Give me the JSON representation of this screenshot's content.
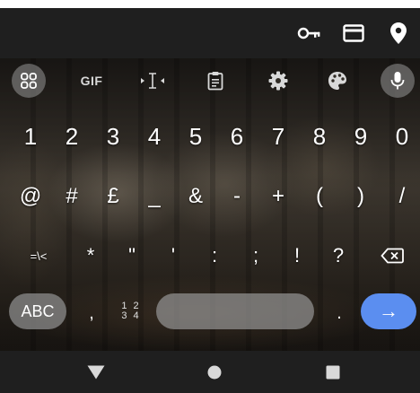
{
  "autofill_bar": {
    "icons": [
      "key-icon",
      "credit-card-icon",
      "location-pin-icon"
    ]
  },
  "keyboard": {
    "toolbar": {
      "gif_label": "GIF",
      "icons": [
        "apps-grid-icon",
        "gif-icon",
        "cursor-control-icon",
        "clipboard-icon",
        "settings-gear-icon",
        "theme-palette-icon",
        "microphone-icon"
      ]
    },
    "row1": [
      "1",
      "2",
      "3",
      "4",
      "5",
      "6",
      "7",
      "8",
      "9",
      "0"
    ],
    "row2": [
      "@",
      "#",
      "£",
      "_",
      "&",
      "-",
      "+",
      "(",
      ")",
      "/"
    ],
    "row3": [
      "=\\<",
      "*",
      "\"",
      "'",
      ":",
      ";",
      "!",
      "?"
    ],
    "row3_backspace_icon": "backspace-icon",
    "bottom_row": {
      "abc_label": "ABC",
      "comma": ",",
      "numpad_top": "1 2",
      "numpad_bottom": "3 4",
      "period": ".",
      "enter_icon": "arrow-right-icon",
      "enter_symbol": "→",
      "enter_color": "#5b8ef0"
    }
  },
  "nav_bar": {
    "icons": [
      "back-triangle-icon",
      "home-circle-icon",
      "recents-square-icon"
    ]
  }
}
